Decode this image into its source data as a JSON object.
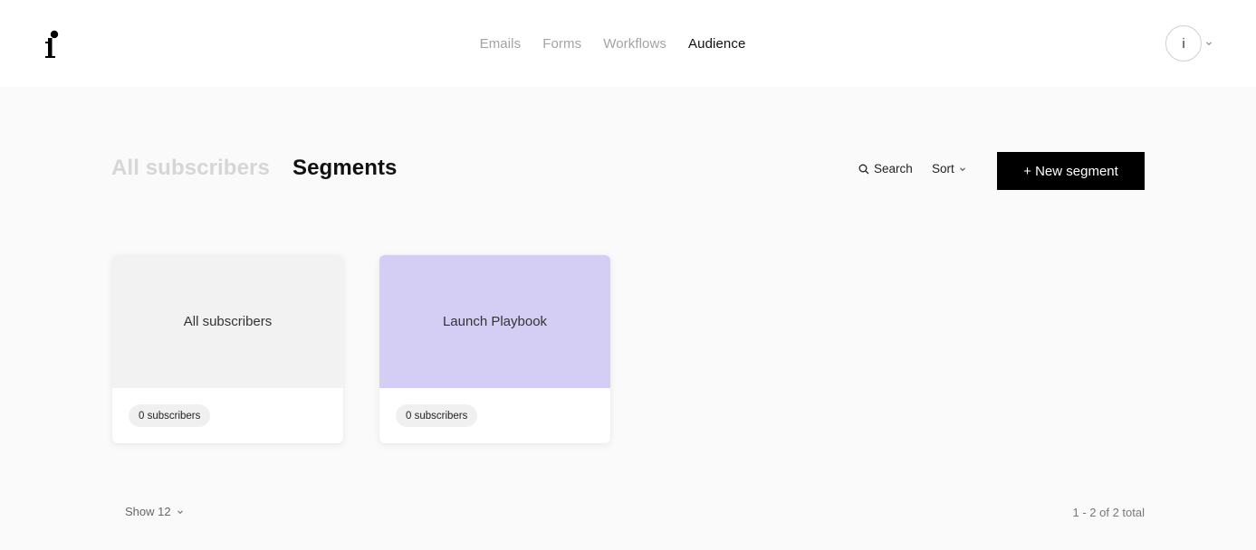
{
  "nav": {
    "items": [
      {
        "label": "Emails",
        "active": false
      },
      {
        "label": "Forms",
        "active": false
      },
      {
        "label": "Workflows",
        "active": false
      },
      {
        "label": "Audience",
        "active": true
      }
    ],
    "logo_icon": "f-logo-icon"
  },
  "account": {
    "avatar_initial": "i",
    "chevron_icon": "chevron-down-icon"
  },
  "tabs": {
    "all_subscribers": "All subscribers",
    "segments": "Segments"
  },
  "toolbar": {
    "search_label": "Search",
    "sort_label": "Sort",
    "new_segment_label": "+ New segment"
  },
  "cards": [
    {
      "title": "All subscribers",
      "count_label": "0 subscribers",
      "color": "#f2f2f2"
    },
    {
      "title": "Launch Playbook",
      "count_label": "0 subscribers",
      "color": "#d4cef5"
    }
  ],
  "footer": {
    "show_label": "Show 12",
    "total_label": "1 - 2 of 2 total"
  },
  "colors": {
    "accent": "#000000",
    "muted_tab": "#d6d6d6",
    "nav_inactive": "#a3a3a3"
  }
}
